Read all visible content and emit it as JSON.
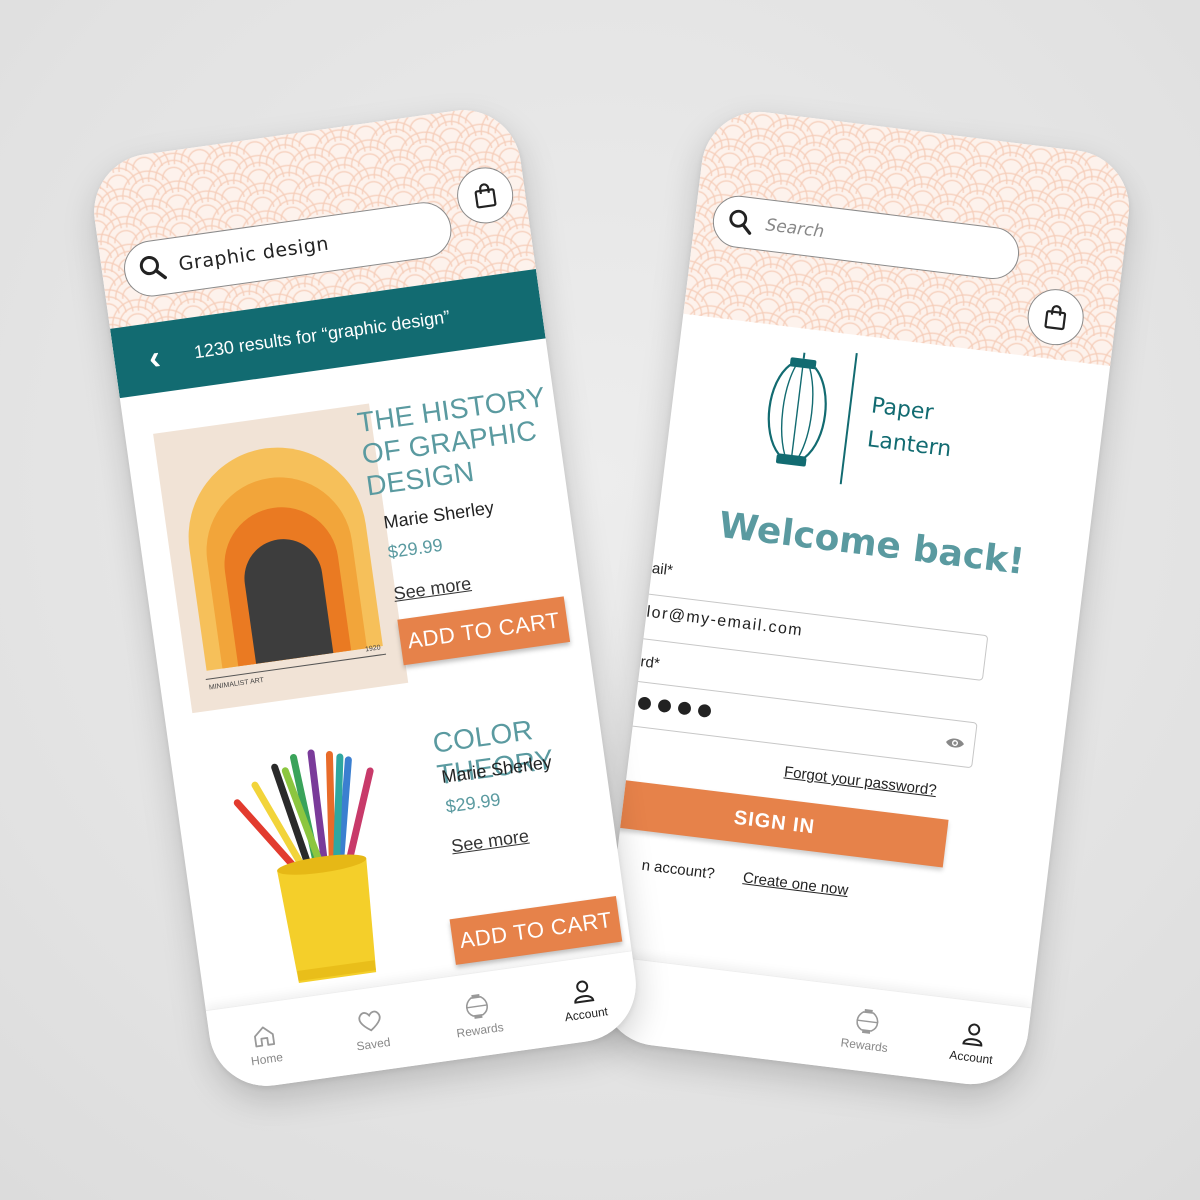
{
  "results_screen": {
    "search": {
      "value": "Graphic design"
    },
    "results_bar": {
      "back": "‹",
      "text": "1230 results for “graphic design”"
    },
    "products": [
      {
        "title_lines": [
          "THE HISTORY",
          "OF GRAPHIC",
          "DESIGN"
        ],
        "author": "Marie Sherley",
        "price": "$29.99",
        "see_more": "See more",
        "add_to_cart": "ADD TO CART",
        "cover_caption_left": "MINIMALIST ART",
        "cover_caption_right": "1920"
      },
      {
        "title_lines": [
          "COLOR THEORY"
        ],
        "author": "Marie Sherley",
        "price": "$29.99",
        "see_more": "See more",
        "add_to_cart": "ADD TO CART"
      }
    ],
    "tabs": [
      {
        "label": "Home",
        "icon": "home-icon",
        "active": false
      },
      {
        "label": "Saved",
        "icon": "heart-icon",
        "active": false
      },
      {
        "label": "Rewards",
        "icon": "lantern-icon",
        "active": false
      },
      {
        "label": "Account",
        "icon": "user-icon",
        "active": true
      }
    ]
  },
  "login_screen": {
    "search": {
      "placeholder": "Search"
    },
    "logo": {
      "line1": "Paper",
      "line2": "Lantern"
    },
    "welcome": "Welcome back!",
    "email": {
      "label": "ail*",
      "value": "lor@my-email.com"
    },
    "password": {
      "label": "rd*",
      "value": "●●●●"
    },
    "forgot": "Forgot your password?",
    "signin": "SIGN IN",
    "no_account": "n account?",
    "create": "Create one now",
    "tabs": [
      {
        "label": "Rewards",
        "icon": "lantern-icon",
        "active": false
      },
      {
        "label": "Account",
        "icon": "user-icon",
        "active": true
      }
    ]
  },
  "colors": {
    "teal": "#126b71",
    "teal_text": "#5a9aa0",
    "orange": "#e6824a",
    "scale_pink": "#f5cdb9"
  }
}
